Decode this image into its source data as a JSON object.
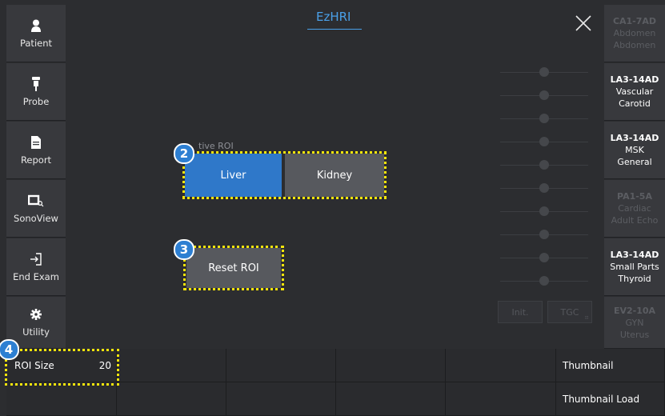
{
  "sidebar": {
    "items": [
      {
        "label": "Patient",
        "icon": "person-icon"
      },
      {
        "label": "Probe",
        "icon": "probe-icon"
      },
      {
        "label": "Report",
        "icon": "document-icon"
      },
      {
        "label": "SonoView",
        "icon": "sonoview-icon"
      },
      {
        "label": "End Exam",
        "icon": "exit-icon"
      },
      {
        "label": "Utility",
        "icon": "gear-icon"
      }
    ]
  },
  "header": {
    "title": "EzHRI"
  },
  "roi": {
    "label": "tive ROI",
    "liver": "Liver",
    "kidney": "Kidney",
    "reset": "Reset ROI"
  },
  "badges": {
    "b2": "2",
    "b3": "3",
    "b4": "4"
  },
  "tgc": {
    "init": "Init.",
    "tgc": "TGC"
  },
  "presets": [
    {
      "probe": "CA1-7AD",
      "line1": "Abdomen",
      "line2": "Abdomen",
      "active": false
    },
    {
      "probe": "LA3-14AD",
      "line1": "Vascular",
      "line2": "Carotid",
      "active": true
    },
    {
      "probe": "LA3-14AD",
      "line1": "MSK",
      "line2": "General",
      "active": true
    },
    {
      "probe": "PA1-5A",
      "line1": "Cardiac",
      "line2": "Adult Echo",
      "active": false
    },
    {
      "probe": "LA3-14AD",
      "line1": "Small Parts",
      "line2": "Thyroid",
      "active": true
    },
    {
      "probe": "EV2-10A",
      "line1": "GYN",
      "line2": "Uterus",
      "active": false
    }
  ],
  "bottom": {
    "roi_size_label": "ROI Size",
    "roi_size_value": "20",
    "thumbnail": "Thumbnail",
    "thumbnail_load": "Thumbnail Load"
  },
  "colors": {
    "accent": "#2f78c9",
    "highlight": "#f5e50c",
    "title": "#4aa0e8"
  }
}
